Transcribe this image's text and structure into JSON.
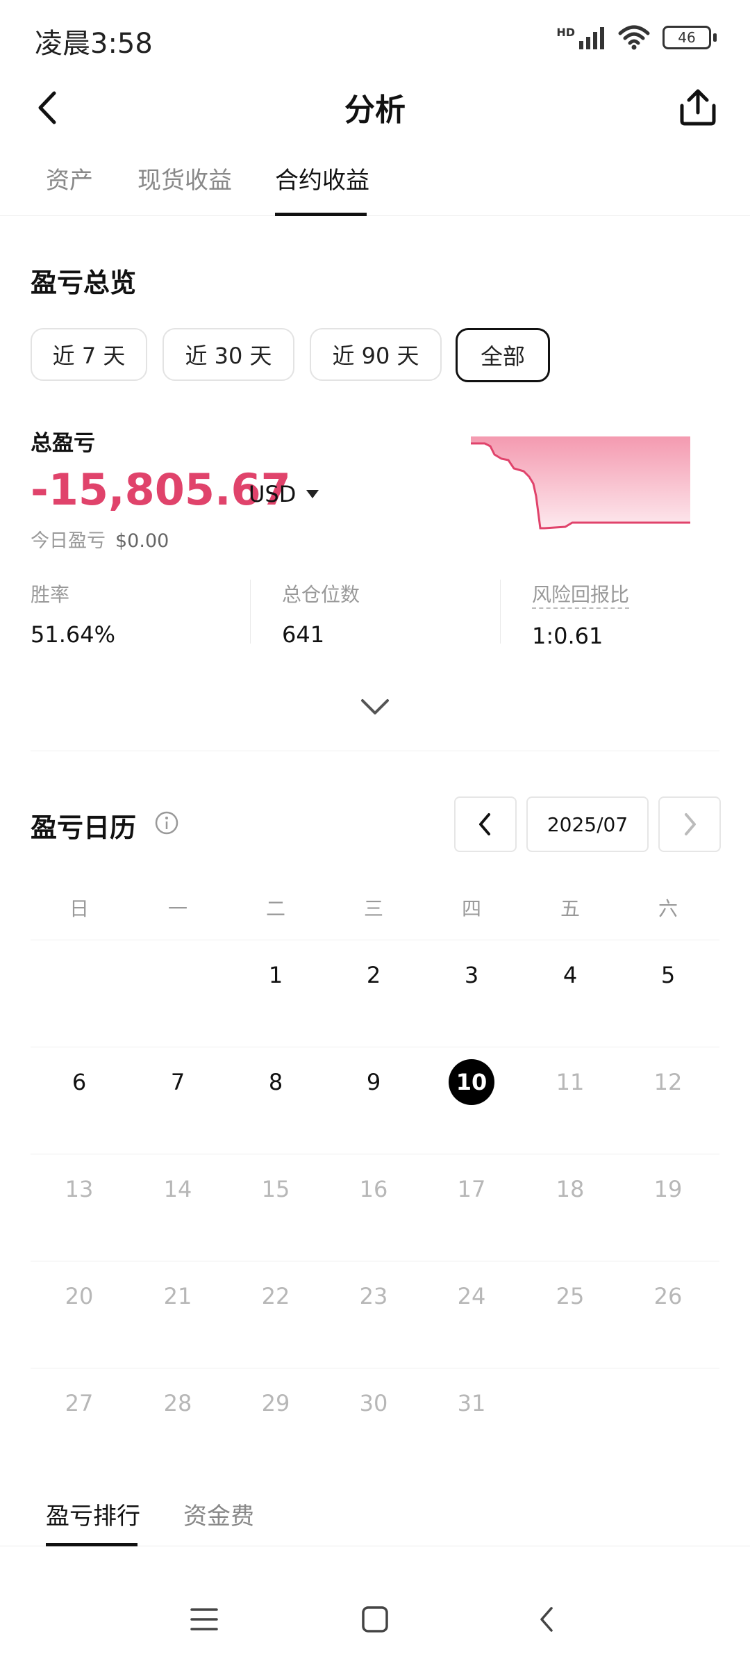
{
  "status_bar": {
    "time": "凌晨3:58",
    "network": "HD",
    "battery": "46"
  },
  "header": {
    "title": "分析"
  },
  "tabs": [
    {
      "label": "资产",
      "active": false
    },
    {
      "label": "现货收益",
      "active": false
    },
    {
      "label": "合约收益",
      "active": true
    }
  ],
  "overview": {
    "title": "盈亏总览",
    "periods": [
      {
        "label": "近 7 天",
        "active": false
      },
      {
        "label": "近 30 天",
        "active": false
      },
      {
        "label": "近 90 天",
        "active": false
      },
      {
        "label": "全部",
        "active": true
      }
    ],
    "total_label": "总盈亏",
    "total_value": "-15,805.67",
    "currency": "USD",
    "today_label": "今日盈亏",
    "today_value": "$0.00",
    "stats": [
      {
        "label": "胜率",
        "value": "51.64%"
      },
      {
        "label": "总仓位数",
        "value": "641"
      },
      {
        "label": "风险回报比",
        "value": "1:0.61"
      }
    ]
  },
  "calendar": {
    "title": "盈亏日历",
    "month": "2025/07",
    "weekdays": [
      "日",
      "一",
      "二",
      "三",
      "四",
      "五",
      "六"
    ],
    "days": [
      "1",
      "2",
      "3",
      "4",
      "5",
      "6",
      "7",
      "8",
      "9",
      "10",
      "11",
      "12",
      "13",
      "14",
      "15",
      "16",
      "17",
      "18",
      "19",
      "20",
      "21",
      "22",
      "23",
      "24",
      "25",
      "26",
      "27",
      "28",
      "29",
      "30",
      "31"
    ],
    "today": "10"
  },
  "bottom_tabs": [
    {
      "label": "盈亏排行",
      "active": true
    },
    {
      "label": "资金费",
      "active": false
    }
  ],
  "colors": {
    "loss": "#e0436b",
    "chart_fill": "#f5a9bb"
  }
}
